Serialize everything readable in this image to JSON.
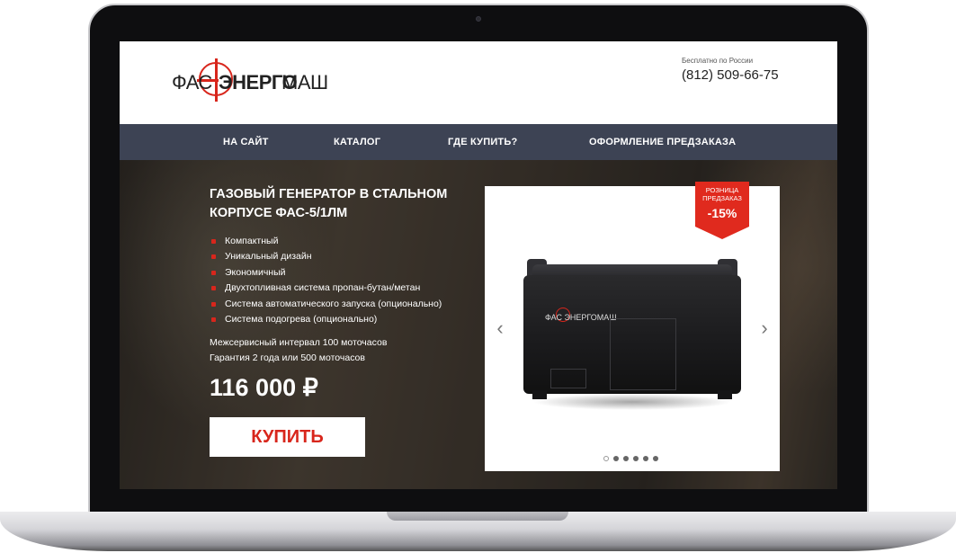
{
  "header": {
    "logo": {
      "part1": "ФАС",
      "part2": "ЭНЕРГО",
      "part3": "МАШ"
    },
    "contact_note": "Бесплатно по России",
    "phone": "(812) 509-66-75"
  },
  "nav": {
    "items": [
      {
        "label": "НА САЙТ"
      },
      {
        "label": "КАТАЛОГ"
      },
      {
        "label": "ГДЕ КУПИТЬ?"
      },
      {
        "label": "ОФОРМЛЕНИЕ ПРЕДЗАКАЗА"
      }
    ]
  },
  "product": {
    "title": "ГАЗОВЫЙ ГЕНЕРАТОР В СТАЛЬНОМ КОРПУСЕ ФАС-5/1ЛМ",
    "features": [
      "Компактный",
      "Уникальный дизайн",
      "Экономичный",
      "Двухтопливная система пропан-бутан/метан",
      "Система автоматического запуска (опционально)",
      "Система подогрева (опционально)"
    ],
    "service_interval": "Межсервисный интервал 100 моточасов",
    "warranty": "Гарантия 2 года или 500 моточасов",
    "price": "116 000 ₽",
    "buy_label": "КУПИТЬ"
  },
  "badge": {
    "line1": "РОЗНИЦА",
    "line2": "ПРЕДЗАКАЗ",
    "discount": "-15%"
  },
  "carousel": {
    "prev_icon": "chevron-left-icon",
    "next_icon": "chevron-right-icon",
    "prev_glyph": "‹",
    "next_glyph": "›",
    "slide_count": 6,
    "active_slide": 1,
    "product_logo": "ФАС ЭНЕРГОМАШ"
  },
  "colors": {
    "accent": "#d8261c",
    "nav_bg": "#3d4354",
    "laptop_frame": "#0e0e10"
  }
}
